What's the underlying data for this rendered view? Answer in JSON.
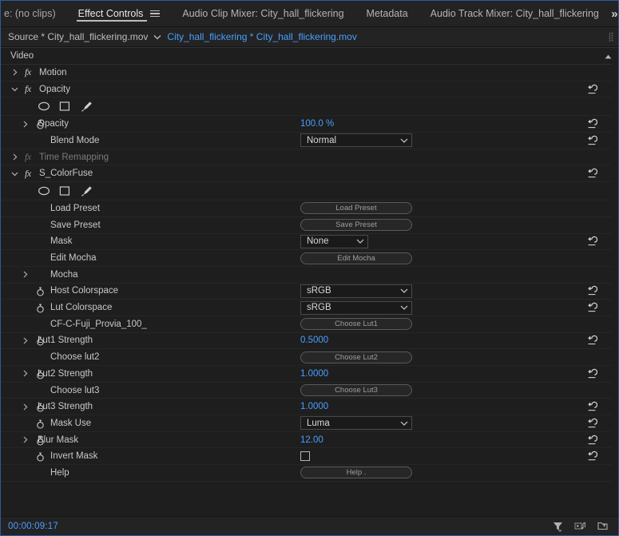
{
  "window": {
    "timecode": "00:00:09:17",
    "accent_blue": "#4a9eff",
    "panel_bg": "#1e1e1e"
  },
  "tabbar": {
    "tabs": [
      {
        "label": "e: (no clips)",
        "active": false
      },
      {
        "label": "Effect Controls",
        "active": true
      },
      {
        "label": "Audio Clip Mixer: City_hall_flickering",
        "active": false
      },
      {
        "label": "Metadata",
        "active": false
      },
      {
        "label": "Audio Track Mixer: City_hall_flickering",
        "active": false
      }
    ],
    "overflow_label": "»"
  },
  "sourcebar": {
    "source_label": "Source * City_hall_flickering.mov",
    "clip_label": "City_hall_flickering * City_hall_flickering.mov"
  },
  "panel": {
    "section_header": "Video",
    "rows": [
      {
        "type": "effect",
        "label": "Motion",
        "expanded": false,
        "fx": true,
        "dim": false
      },
      {
        "type": "effect",
        "label": "Opacity",
        "expanded": true,
        "fx": true,
        "dim": false,
        "reset": true
      },
      {
        "type": "masktools"
      },
      {
        "type": "param",
        "label": "Opacity",
        "indent": 2,
        "triangle": true,
        "stopwatch": true,
        "value": "100.0 %",
        "reset": true
      },
      {
        "type": "param",
        "label": "Blend Mode",
        "indent": 3,
        "dropdown": "Normal",
        "dropdown_w": 140,
        "reset": true
      },
      {
        "type": "effect",
        "label": "Time Remapping",
        "expanded": false,
        "fx": true,
        "dim": true
      },
      {
        "type": "effect",
        "label": "S_ColorFuse",
        "expanded": true,
        "fx": true,
        "dim": false,
        "reset": true
      },
      {
        "type": "masktools"
      },
      {
        "type": "param",
        "label": "Load Preset",
        "indent": 3,
        "button": "Load Preset"
      },
      {
        "type": "param",
        "label": "Save Preset",
        "indent": 3,
        "button": "Save Preset"
      },
      {
        "type": "param",
        "label": "Mask",
        "indent": 3,
        "dropdown": "None",
        "dropdown_w": 85,
        "reset": true
      },
      {
        "type": "param",
        "label": "Edit Mocha",
        "indent": 3,
        "button": "Edit Mocha"
      },
      {
        "type": "param",
        "label": "Mocha",
        "indent": 3,
        "triangle": true
      },
      {
        "type": "param",
        "label": "Host Colorspace",
        "indent": 3,
        "stopwatch": true,
        "dropdown": "sRGB",
        "dropdown_w": 140,
        "reset": true
      },
      {
        "type": "param",
        "label": "Lut Colorspace",
        "indent": 3,
        "stopwatch": true,
        "dropdown": "sRGB",
        "dropdown_w": 140,
        "reset": true
      },
      {
        "type": "param",
        "label": "CF-C-Fuji_Provia_100_",
        "indent": 3,
        "button": "Choose Lut1"
      },
      {
        "type": "param",
        "label": "Lut1 Strength",
        "indent": 2,
        "triangle": true,
        "stopwatch": true,
        "value": "0.5000",
        "reset": true
      },
      {
        "type": "param",
        "label": "Choose lut2",
        "indent": 3,
        "button": "Choose Lut2"
      },
      {
        "type": "param",
        "label": "Lut2 Strength",
        "indent": 2,
        "triangle": true,
        "stopwatch": true,
        "value": "1.0000",
        "reset": true
      },
      {
        "type": "param",
        "label": "Choose lut3",
        "indent": 3,
        "button": "Choose Lut3"
      },
      {
        "type": "param",
        "label": "Lut3 Strength",
        "indent": 2,
        "triangle": true,
        "stopwatch": true,
        "value": "1.0000",
        "reset": true
      },
      {
        "type": "param",
        "label": "Mask Use",
        "indent": 3,
        "stopwatch": true,
        "dropdown": "Luma",
        "dropdown_w": 140,
        "reset": true
      },
      {
        "type": "param",
        "label": "Blur Mask",
        "indent": 2,
        "triangle": true,
        "stopwatch": true,
        "value": "12.00",
        "reset": true
      },
      {
        "type": "param",
        "label": "Invert Mask",
        "indent": 3,
        "stopwatch": true,
        "checkbox": false,
        "reset": true
      },
      {
        "type": "param",
        "label": "Help",
        "indent": 3,
        "button": "Help  ."
      }
    ]
  },
  "statusbar": {
    "timecode": "00:00:09:17",
    "icons": [
      {
        "name": "filter-icon"
      },
      {
        "name": "audio-preview-icon"
      },
      {
        "name": "export-icon"
      }
    ]
  }
}
